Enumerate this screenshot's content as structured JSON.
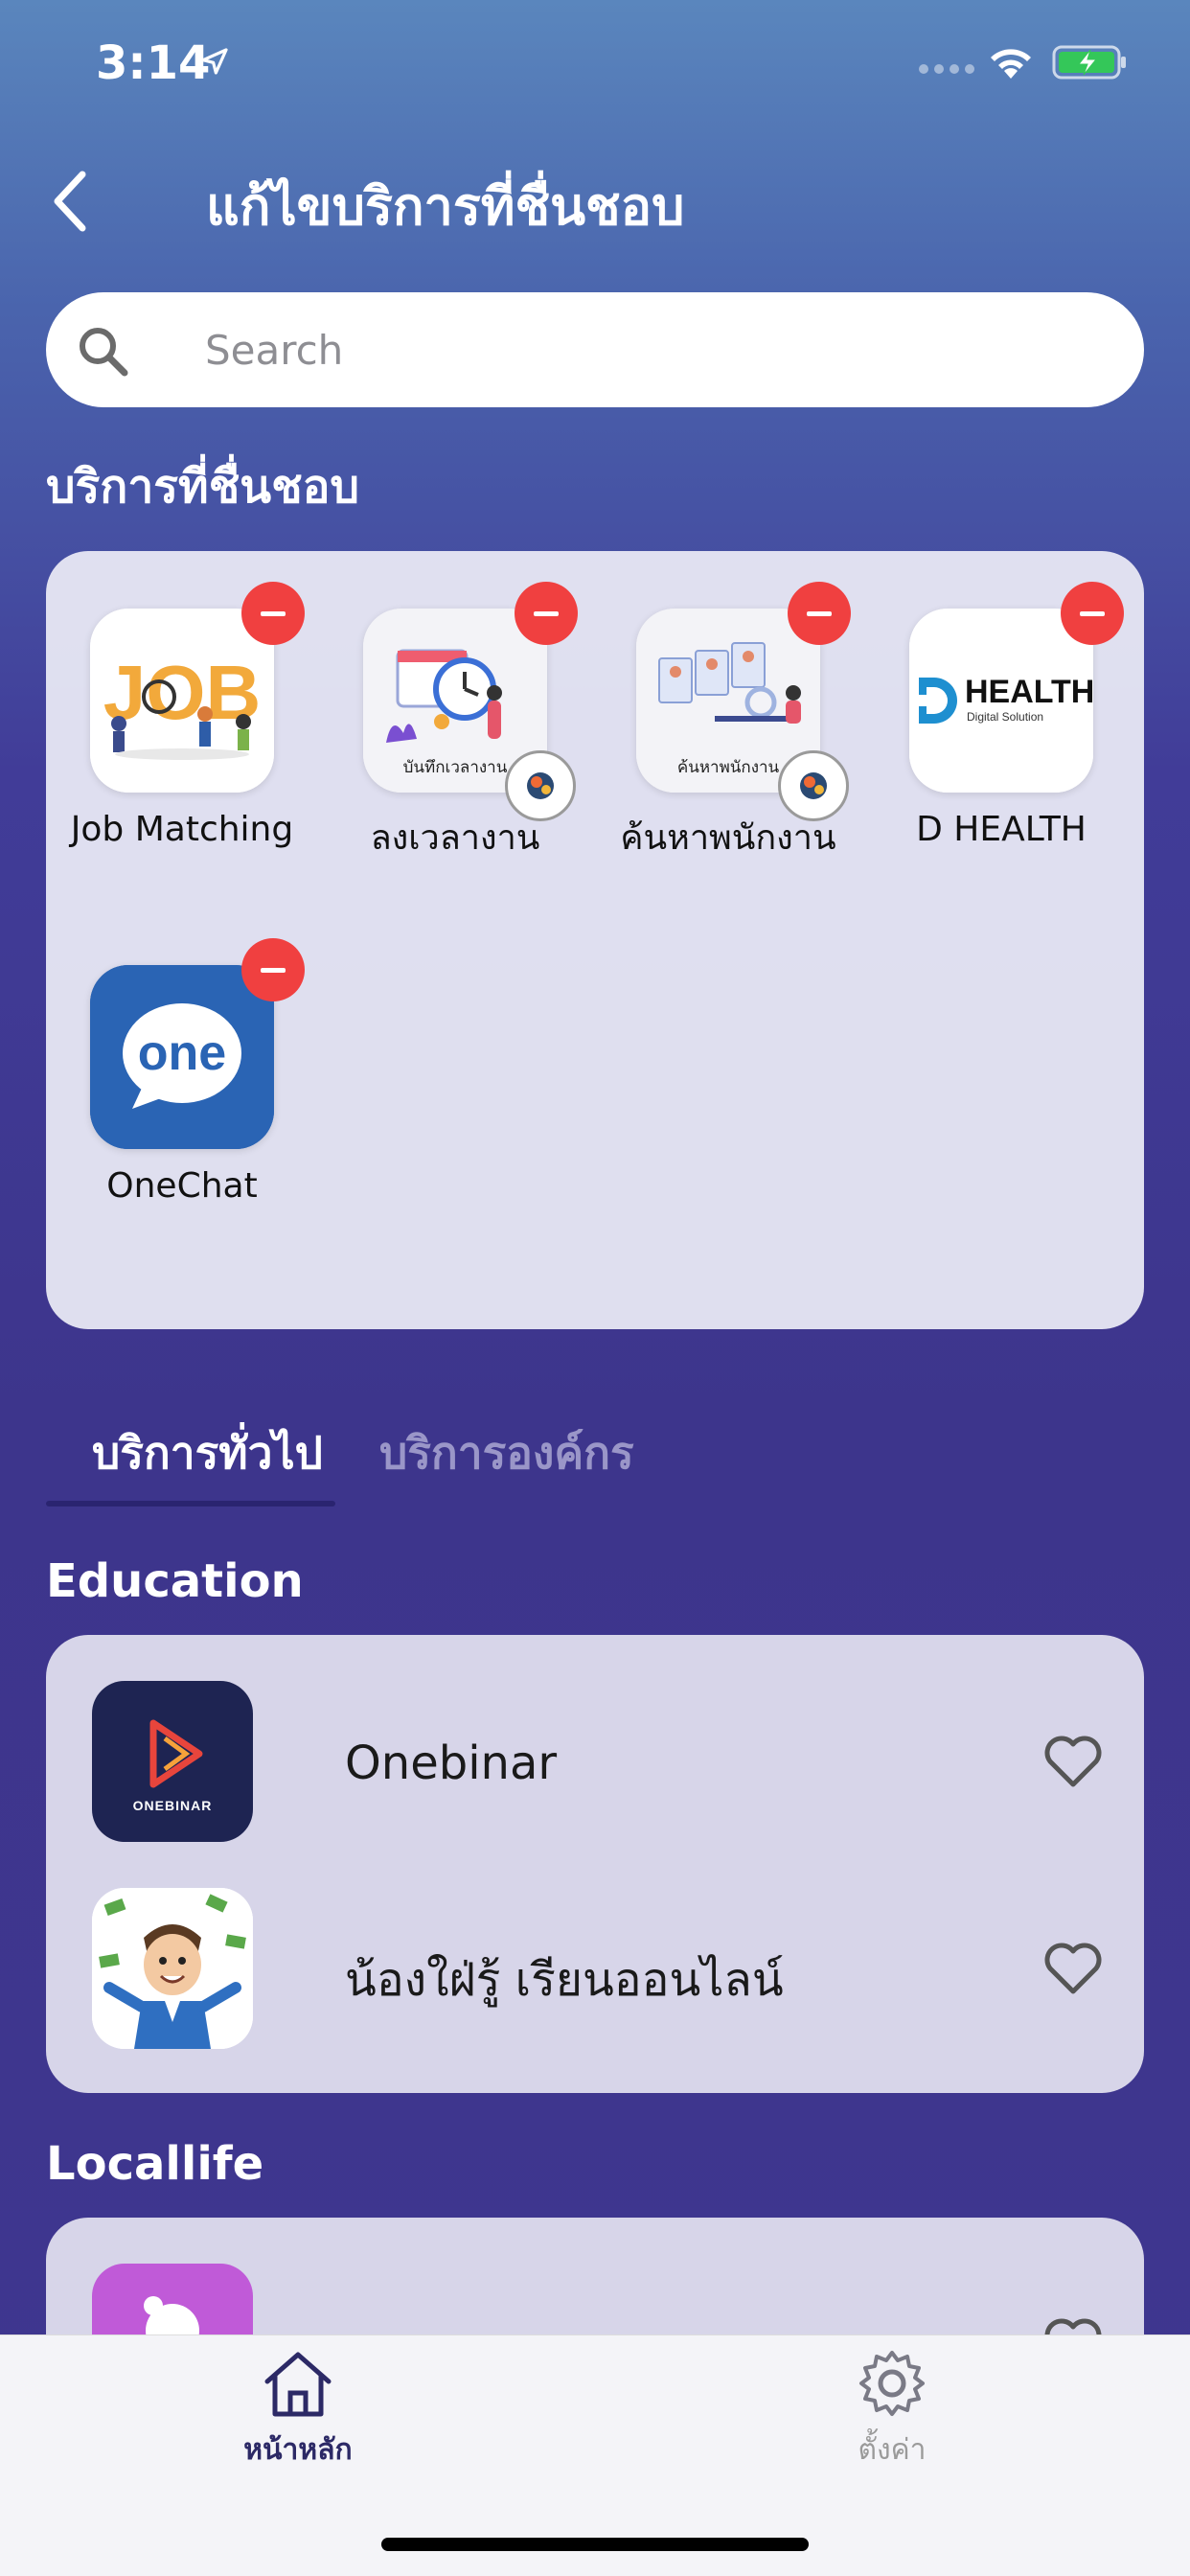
{
  "status_bar": {
    "time": "3:14"
  },
  "header": {
    "title": "แก้ไขบริการที่ชื่นชอบ"
  },
  "search": {
    "placeholder": "Search"
  },
  "favorites": {
    "title": "บริการที่ชื่นชอบ",
    "items": [
      {
        "label": "Job Matching",
        "icon": "job-matching-logo"
      },
      {
        "label": "ลงเวลางาน",
        "icon": "time-attendance-logo",
        "tile_caption": "บันทึกเวลางาน"
      },
      {
        "label": "ค้นหาพนักงาน",
        "icon": "employee-search-logo",
        "tile_caption": "ค้นหาพนักงาน"
      },
      {
        "label": "D HEALTH",
        "icon": "d-health-logo",
        "logo_text": "HEALTH",
        "logo_sub": "Digital Solution"
      },
      {
        "label": "OneChat",
        "icon": "onechat-logo",
        "logo_text": "one"
      }
    ]
  },
  "tabs": [
    {
      "label": "บริการทั่วไป",
      "active": true
    },
    {
      "label": "บริการองค์กร",
      "active": false
    }
  ],
  "categories": [
    {
      "title": "Education",
      "items": [
        {
          "label": "Onebinar",
          "icon": "onebinar-logo",
          "logo_text": "ONEBINAR"
        },
        {
          "label": "น้องใฝ่รู้ เรียนออนไลน์",
          "icon": "nong-fai-ru-logo"
        }
      ]
    },
    {
      "title": "Locallife",
      "items": [
        {
          "label": "",
          "icon": "locallife-app-logo"
        }
      ]
    }
  ],
  "bottom_nav": {
    "home_label": "หน้าหลัก",
    "settings_label": "ตั้งค่า"
  },
  "colors": {
    "accent": "#2c2966",
    "remove_badge": "#f04040",
    "onechat_blue": "#2a64b4",
    "onebinar_navy": "#1e2452"
  }
}
